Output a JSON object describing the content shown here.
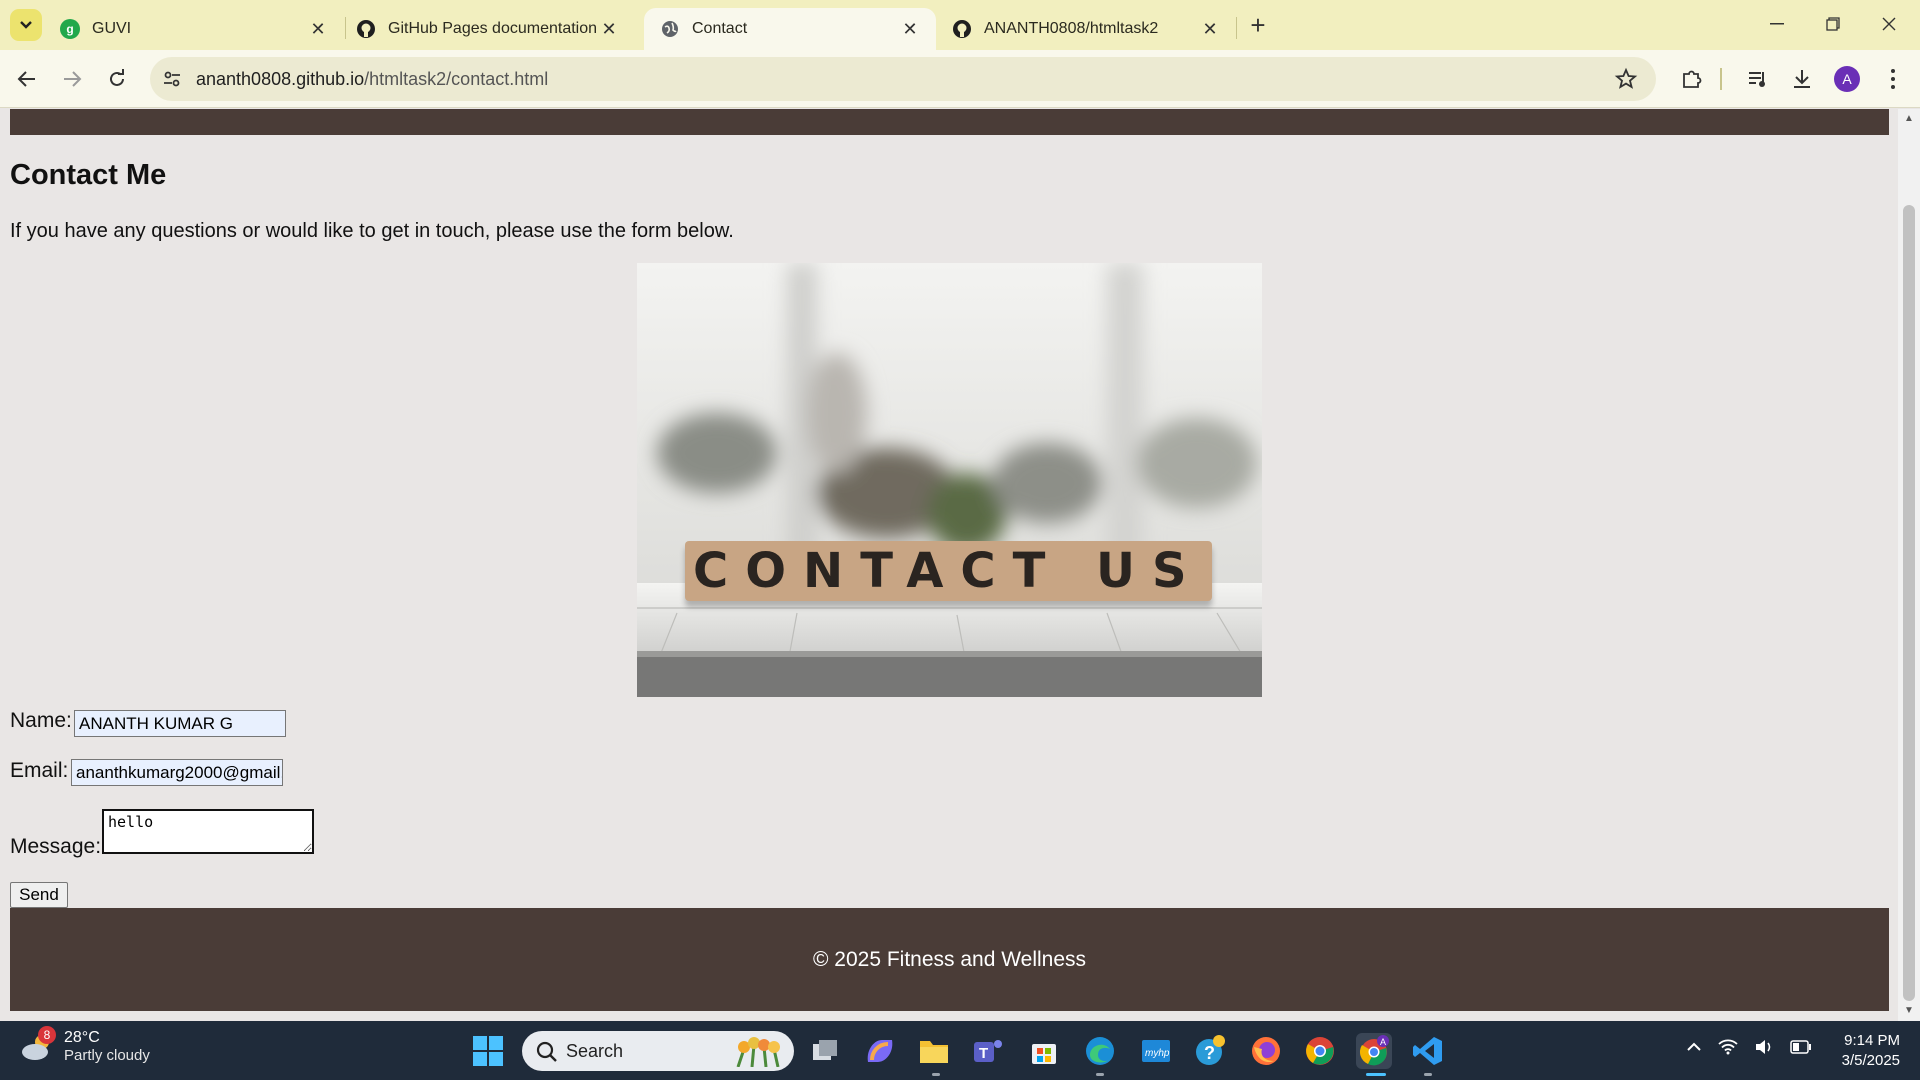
{
  "browser": {
    "tabs": [
      {
        "title": "GUVI",
        "active": false,
        "favicon": "guvi-icon"
      },
      {
        "title": "GitHub Pages documentation -",
        "active": false,
        "favicon": "github-icon"
      },
      {
        "title": "Contact",
        "active": true,
        "favicon": "globe-icon"
      },
      {
        "title": "ANANTH0808/htmltask2",
        "active": false,
        "favicon": "github-icon"
      }
    ],
    "url_host": "ananth0808.github.io",
    "url_path": "/htmltask2/contact.html",
    "profile_initial": "A"
  },
  "page": {
    "heading": "Contact Me",
    "intro": "If you have any questions or would like to get in touch, please use the form below.",
    "image_text": "CONTACT US",
    "form": {
      "name_label": "Name:",
      "name_value": "ANANTH KUMAR G",
      "email_label": "Email:",
      "email_value": "ananthkumarg2000@gmail.",
      "message_label": "Message:",
      "message_value": "hello",
      "send_label": "Send"
    },
    "footer": "© 2025 Fitness and Wellness"
  },
  "taskbar": {
    "weather_badge": "8",
    "temperature": "28°C",
    "condition": "Partly cloudy",
    "search_label": "Search",
    "time": "9:14 PM",
    "date": "3/5/2025",
    "colors": {
      "nav": "#4a3c37",
      "page_bg": "#e9e6e5",
      "tab_strip": "#f2efbf"
    }
  }
}
